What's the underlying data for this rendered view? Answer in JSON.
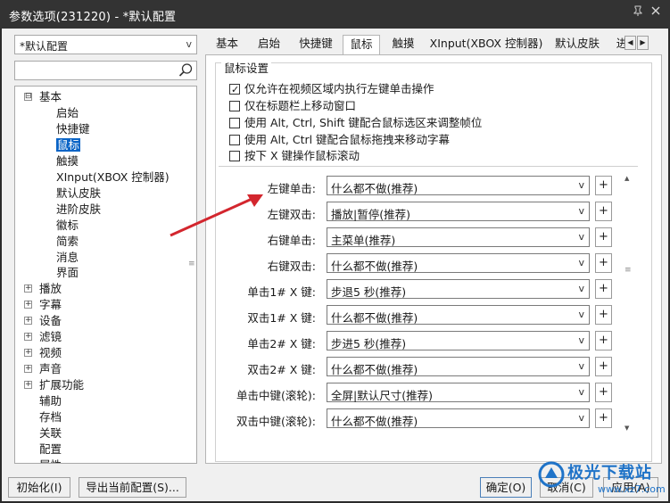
{
  "window": {
    "title": "参数选项(231220) - *默认配置",
    "pin_icon": "pin-icon",
    "close_icon": "close-icon"
  },
  "profile_select": {
    "value": "*默认配置"
  },
  "search": {
    "value": ""
  },
  "tree": {
    "items": [
      {
        "label": "基本",
        "expander": "⊟"
      },
      {
        "label": "启始"
      },
      {
        "label": "快捷键"
      },
      {
        "label": "鼠标",
        "selected": true
      },
      {
        "label": "触摸"
      },
      {
        "label": "XInput(XBOX 控制器)"
      },
      {
        "label": "默认皮肤"
      },
      {
        "label": "进阶皮肤"
      },
      {
        "label": "徽标"
      },
      {
        "label": "简索"
      },
      {
        "label": "消息"
      },
      {
        "label": "界面"
      },
      {
        "label": "播放",
        "expander": "+"
      },
      {
        "label": "字幕",
        "expander": "+"
      },
      {
        "label": "设备",
        "expander": "+"
      },
      {
        "label": "滤镜",
        "expander": "+"
      },
      {
        "label": "视频",
        "expander": "+"
      },
      {
        "label": "声音",
        "expander": "+"
      },
      {
        "label": "扩展功能",
        "expander": "+"
      },
      {
        "label": "辅助"
      },
      {
        "label": "存档"
      },
      {
        "label": "关联"
      },
      {
        "label": "配置"
      },
      {
        "label": "属性"
      }
    ]
  },
  "tabs": [
    "基本",
    "启始",
    "快捷键",
    "鼠标",
    "触摸",
    "XInput(XBOX 控制器)",
    "默认皮肤",
    "进"
  ],
  "active_tab": "鼠标",
  "mouse_settings": {
    "group_title": "鼠标设置",
    "checkboxes": [
      {
        "label": "仅允许在视频区域内执行左键单击操作",
        "checked": true
      },
      {
        "label": "仅在标题栏上移动窗口",
        "checked": false
      },
      {
        "label": "使用 Alt, Ctrl, Shift 键配合鼠标选区来调整帧位",
        "checked": false
      },
      {
        "label": "使用 Alt, Ctrl 键配合鼠标拖拽来移动字幕",
        "checked": false
      },
      {
        "label": "按下 X 键操作鼠标滚动",
        "checked": false
      }
    ],
    "actions": [
      {
        "label": "左键单击:",
        "value": "什么都不做(推荐)"
      },
      {
        "label": "左键双击:",
        "value": "播放|暂停(推荐)"
      },
      {
        "label": "右键单击:",
        "value": "主菜单(推荐)"
      },
      {
        "label": "右键双击:",
        "value": "什么都不做(推荐)"
      },
      {
        "label": "单击1# X 键:",
        "value": "步退5 秒(推荐)"
      },
      {
        "label": "双击1# X 键:",
        "value": "什么都不做(推荐)"
      },
      {
        "label": "单击2# X 键:",
        "value": "步进5 秒(推荐)"
      },
      {
        "label": "双击2# X 键:",
        "value": "什么都不做(推荐)"
      },
      {
        "label": "单击中键(滚轮):",
        "value": "全屏|默认尺寸(推荐)"
      },
      {
        "label": "双击中键(滚轮):",
        "value": "什么都不做(推荐)"
      }
    ],
    "plus_label": "+",
    "dropdown_arrow": "v"
  },
  "buttons": {
    "init": "初始化(I)",
    "export": "导出当前配置(S)...",
    "ok": "确定(O)",
    "cancel": "取消(C)",
    "apply": "应用(A)"
  },
  "watermark": {
    "text": "极光下载站",
    "url": "www.xz7.com"
  },
  "colors": {
    "titlebar": "#333333",
    "selection": "#0a64c6",
    "annotation_arrow": "#d3262e",
    "watermark": "#1f73c8"
  }
}
